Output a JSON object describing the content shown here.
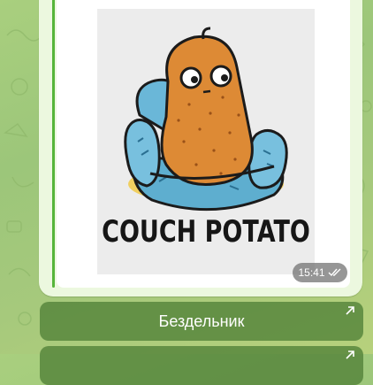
{
  "message": {
    "poster_caption": "COUCH POTATO",
    "time": "15:41",
    "read_status_icon": "double-check-icon"
  },
  "inline_keyboard": {
    "buttons": [
      {
        "label": "Бездельник",
        "icon": "open-link-arrow-icon"
      },
      {
        "label": "",
        "icon": "open-link-arrow-icon"
      }
    ]
  },
  "colors": {
    "wallpaper": "#a6cb7c",
    "bubble": "#ecf8df",
    "reply_bar": "#56b53a",
    "button": "#54843a"
  }
}
